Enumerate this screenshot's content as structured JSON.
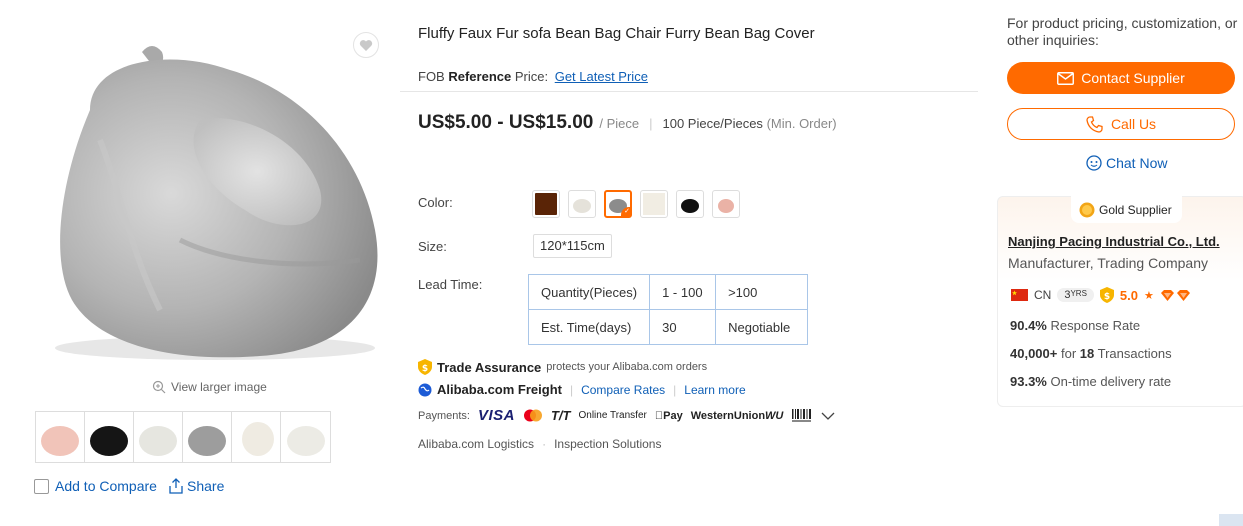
{
  "product": {
    "title": "Fluffy Faux Fur sofa Bean Bag Chair Furry Bean Bag Cover",
    "fob_prefix": "FOB",
    "fob_bold": "Reference",
    "fob_suffix": "Price:",
    "fob_link": "Get Latest Price",
    "price": "US$5.00 - US$15.00",
    "price_unit": "/ Piece",
    "moq_value": "100 Piece/Pieces",
    "moq_label": "(Min. Order)",
    "color_label": "Color:",
    "size_label": "Size:",
    "size_value": "120*115cm",
    "lead_label": "Lead Time:",
    "lead_table": {
      "row1": [
        "Quantity(Pieces)",
        "1 - 100",
        ">100"
      ],
      "row2": [
        "Est. Time(days)",
        "30",
        "Negotiable"
      ]
    },
    "swatches": [
      {
        "name": "brown",
        "color": "#5a2406"
      },
      {
        "name": "white-fluffy",
        "color": "#ece9e2"
      },
      {
        "name": "grey",
        "color": "#8c8c8c"
      },
      {
        "name": "cream",
        "color": "#f1ede3"
      },
      {
        "name": "black",
        "color": "#111111"
      },
      {
        "name": "pink",
        "color": "#eab2a6"
      }
    ],
    "selected_swatch": 2
  },
  "gallery": {
    "view_larger": "View larger image",
    "add_to_compare": "Add to Compare",
    "share": "Share",
    "thumbnails": [
      "#f1c4b9",
      "#151515",
      "#eeeeea",
      "#9d9d9d",
      "#f4f1ea",
      "#f3f1ec"
    ]
  },
  "trade": {
    "ta_title": "Trade Assurance",
    "ta_desc": "protects your Alibaba.com orders",
    "freight_title": "Alibaba.com Freight",
    "compare_rates": "Compare Rates",
    "learn_more": "Learn more",
    "payments_label": "Payments:",
    "pay_visa": "VISA",
    "pay_tt": "T/T",
    "pay_online": "Online Transfer",
    "pay_apple": "Pay",
    "pay_wu": "WesternUnion",
    "pay_wu2": "WU",
    "logistics": "Alibaba.com Logistics",
    "inspection": "Inspection Solutions"
  },
  "supplier": {
    "inquiry_text": "For product pricing, customization, or other inquiries:",
    "contact_btn": "Contact Supplier",
    "call_btn": "Call Us",
    "chat_btn": "Chat Now",
    "gold_badge": "Gold Supplier",
    "company": "Nanjing Pacing Industrial Co., Ltd.",
    "company_type": "Manufacturer, Trading Company",
    "country": "CN",
    "years_num": "3",
    "years_unit": "YRS",
    "rating": "5.0",
    "response_rate_value": "90.4%",
    "response_rate_label": "Response Rate",
    "transactions_prefix": "40,000+",
    "transactions_mid": "for",
    "transactions_count": "18",
    "transactions_label": "Transactions",
    "ontime_value": "93.3%",
    "ontime_label": "On-time delivery rate"
  }
}
